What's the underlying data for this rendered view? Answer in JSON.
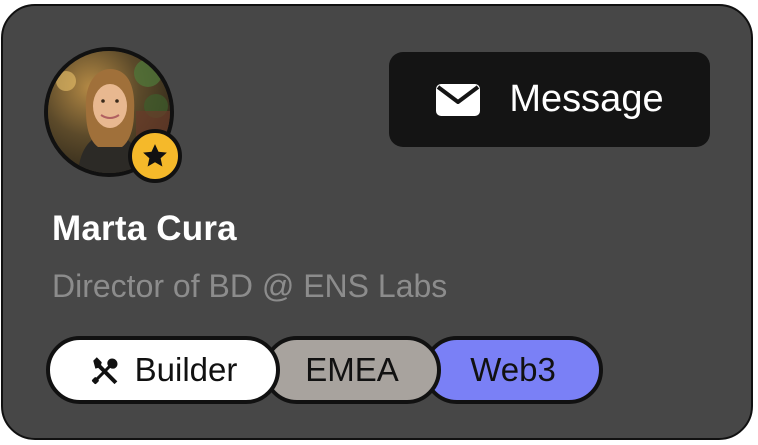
{
  "profile": {
    "name": "Marta Cura",
    "title": "Director of BD @ ENS Labs",
    "avatar_badge_icon": "star-icon"
  },
  "actions": {
    "message_label": "Message",
    "message_icon": "envelope-icon"
  },
  "tags": [
    {
      "label": "Builder",
      "icon": "tools-icon",
      "color": "#ffffff"
    },
    {
      "label": "EMEA",
      "color": "#a8a39e"
    },
    {
      "label": "Web3",
      "color": "#7a80f6"
    }
  ],
  "colors": {
    "card_background": "#474747",
    "badge": "#f5b92a",
    "button": "#141414"
  }
}
